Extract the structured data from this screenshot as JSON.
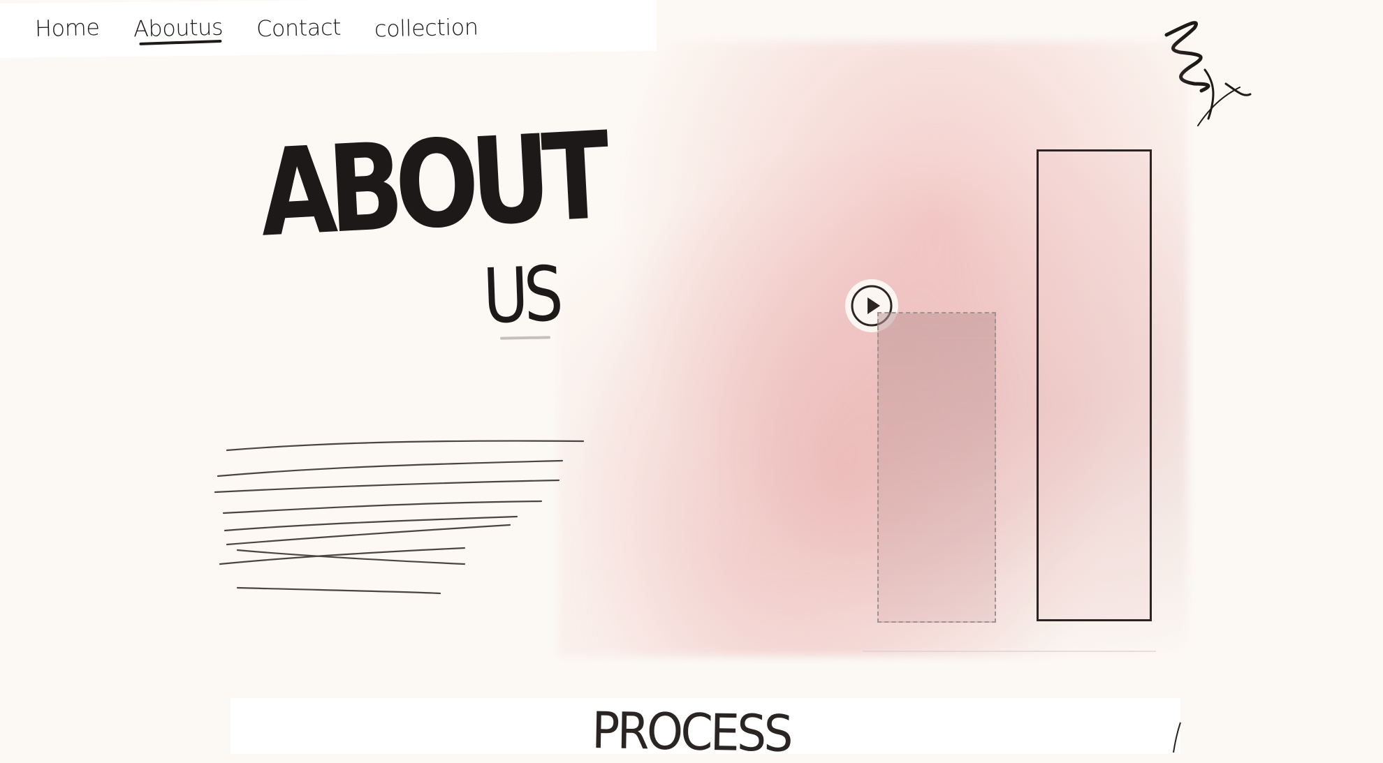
{
  "nav": {
    "items": [
      {
        "label": "Home",
        "active": false
      },
      {
        "label": "Aboutus",
        "active": true
      },
      {
        "label": "Contact",
        "active": false
      },
      {
        "label": "collection",
        "active": false
      }
    ]
  },
  "hero": {
    "title_line1": "ABOUT",
    "title_line2": "US"
  },
  "media": {
    "play_icon": "play-icon"
  },
  "sections": {
    "process_title": "PROCESS"
  },
  "colors": {
    "background": "#fcf8f3",
    "ink": "#1d1a19",
    "blush": "#eca8a8"
  }
}
